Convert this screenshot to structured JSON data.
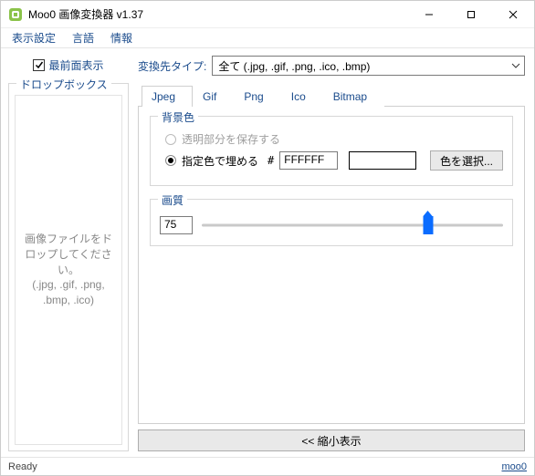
{
  "window": {
    "title": "Moo0 画像変換器 v1.37"
  },
  "menu": {
    "display_settings": "表示設定",
    "language": "言語",
    "info": "情報"
  },
  "left": {
    "topmost_label": "最前面表示",
    "topmost_checked": true,
    "dropbox_label": "ドロップボックス",
    "dropzone_text": "画像ファイルをドロップしてください。\n(.jpg, .gif, .png, .bmp, .ico)"
  },
  "right": {
    "convert_type_label": "変換先タイプ:",
    "convert_type_value": "全て (.jpg, .gif, .png, .ico, .bmp)",
    "tabs": {
      "jpeg": "Jpeg",
      "gif": "Gif",
      "png": "Png",
      "ico": "Ico",
      "bitmap": "Bitmap"
    },
    "bg_group_label": "背景色",
    "radio_keep_transparent": "透明部分を保存する",
    "radio_fill_color": "指定色で埋める",
    "hash": "#",
    "hex_value": "FFFFFF",
    "choose_color_btn": "色を選択...",
    "quality_group_label": "画質",
    "quality_value": "75",
    "quality_percent": 75,
    "collapse_btn": "<< 縮小表示"
  },
  "status": {
    "left": "Ready",
    "right": "moo0"
  }
}
